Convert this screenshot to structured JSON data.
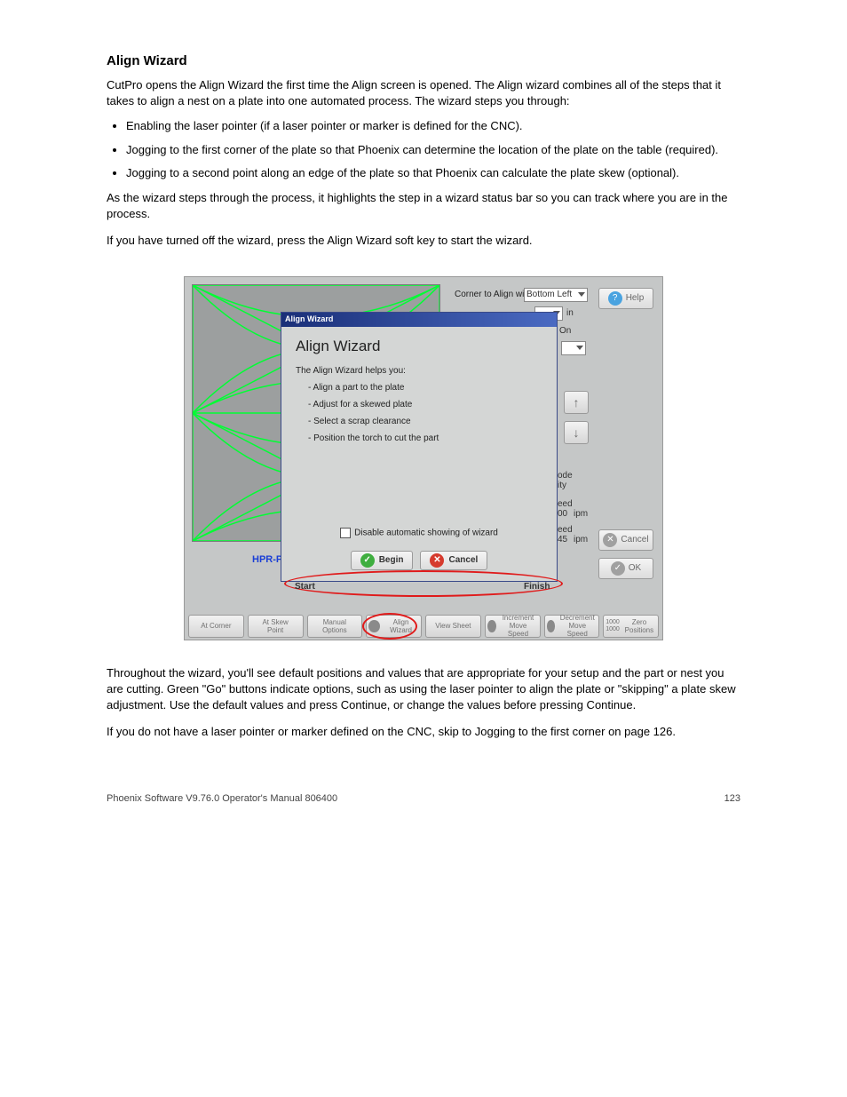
{
  "heading": "Align Wizard",
  "intro": "CutPro opens the Align Wizard the first time the Align screen is opened. The Align wizard combines all of the steps that it takes to align a nest on a plate into one automated process. The wizard steps you through:",
  "bullets": [
    "Enabling the laser pointer (if a laser pointer or marker is defined for the CNC).",
    "Jogging to the first corner of the plate so that Phoenix can determine the location of the plate on the table (required).",
    "Jogging to a second point along an edge of the plate so that Phoenix can calculate the plate skew (optional)."
  ],
  "para_afterlist": "As the wizard steps through the process, it highlights the step in a wizard status bar so you can track where you are in the process.",
  "para_ifoff": "If you have turned off the wizard, press the Align Wizard soft key to start the wizard.",
  "shot": {
    "corner_label": "Corner to Align with",
    "corner_value": "Bottom Left",
    "laser_on": "On",
    "mode": "ode",
    "ity": "ity",
    "speed1_label": "eed",
    "speed1_val": "00",
    "speed_unit": "ipm",
    "speed2_label": "eed",
    "speed2_val": "45",
    "in_unit": "in",
    "help": "Help",
    "cancel": "Cancel",
    "ok": "OK",
    "hpr": "HPR-P",
    "dialog": {
      "titlebar": "Align Wizard",
      "heading": "Align Wizard",
      "helps": "The Align Wizard helps you:",
      "b1": "- Align a part to the plate",
      "b2": "- Adjust for a skewed plate",
      "b3": "- Select a scrap clearance",
      "b4": "- Position the torch to cut the part",
      "disable": "Disable automatic showing of wizard",
      "begin": "Begin",
      "cancel": "Cancel"
    },
    "start": "Start",
    "finish": "Finish",
    "toolbar": {
      "t1": "At Corner",
      "t2": "At Skew Point",
      "t3": "Manual Options",
      "t4": "Align Wizard",
      "t5": "View Sheet",
      "t6": "Increment Move Speed",
      "t7": "Decrement Move Speed",
      "t8l1": "1000",
      "t8l2": "1000",
      "t8": "Zero Positions"
    }
  },
  "after1": "Throughout the wizard, you'll see default positions and values that are appropriate for your setup and the part or nest you are cutting. Green \"Go\" buttons indicate options, such as using the laser pointer to align the plate or \"skipping\" a plate skew adjustment. Use the default values and press Continue, or change the values before pressing Continue.",
  "after2": "If you do not have a laser pointer or marker defined on the CNC, skip to Jogging to the first corner on page 126.",
  "footer_left": "Phoenix Software V9.76.0 Operator's Manual 806400",
  "footer_right": "123"
}
